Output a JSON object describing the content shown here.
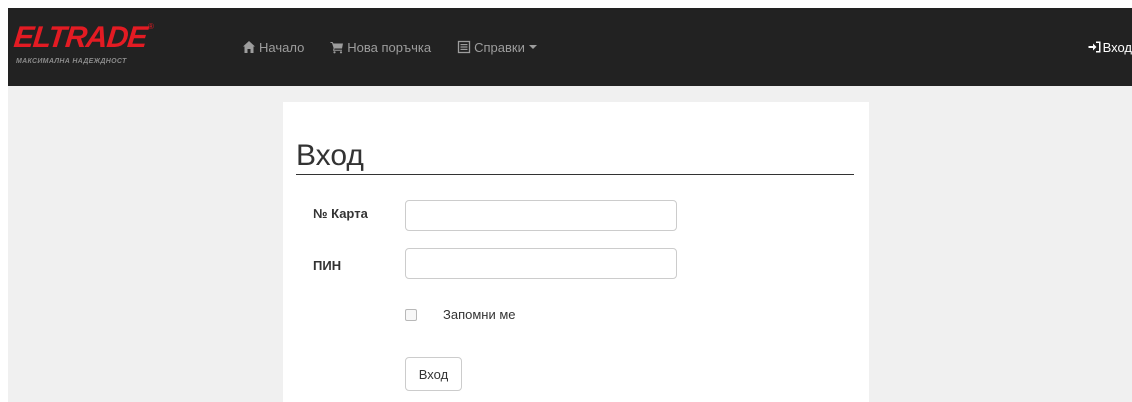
{
  "brand": {
    "name": "ELTRADE",
    "registered": "®",
    "tagline": "МАКСИМАЛНА НАДЕЖДНОСТ",
    "color": "#e31b23"
  },
  "nav": {
    "items": [
      {
        "label": "Начало",
        "icon": "home-icon"
      },
      {
        "label": "Нова поръчка",
        "icon": "shopping-cart-icon"
      },
      {
        "label": "Справки",
        "icon": "list-alt-icon",
        "dropdown": true
      }
    ],
    "login": {
      "label": "Вход",
      "icon": "log-in-icon"
    }
  },
  "login_form": {
    "title": "Вход",
    "card_label": "№ Карта",
    "card_value": "",
    "pin_label": "ПИН",
    "pin_value": "",
    "remember_label": "Запомни ме",
    "remember_checked": false,
    "submit_label": "Вход"
  },
  "colors": {
    "navbar_bg": "#222222",
    "nav_text": "#9d9d9d",
    "page_bg": "#f0f0f0"
  }
}
